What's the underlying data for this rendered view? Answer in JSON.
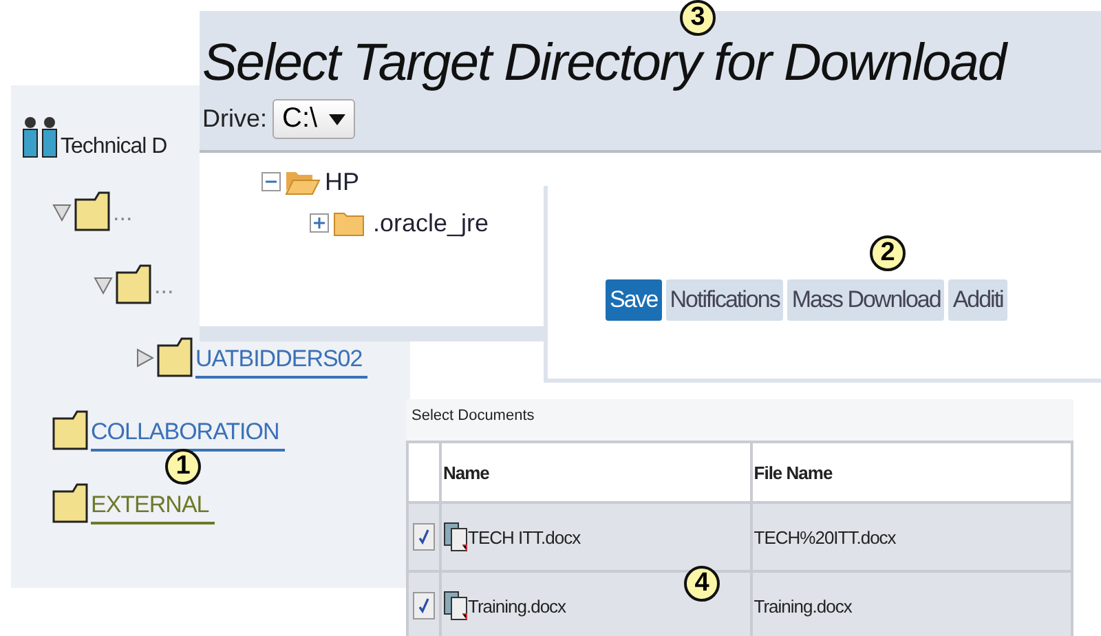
{
  "directory_dialog": {
    "title": "Select Target Directory for Download",
    "drive_label": "Drive:",
    "drive_value": "C:\\",
    "folders": [
      {
        "label": "HP",
        "expanded": true,
        "children": [
          {
            "label": ".oracle_jre",
            "expanded": false
          }
        ]
      }
    ]
  },
  "tree": {
    "root": "Technical D",
    "children": [
      {
        "label": "...",
        "expanded": true,
        "children": [
          {
            "label": "...",
            "expanded": true,
            "children": [
              {
                "label": "UATBIDDERS02",
                "expanded": false,
                "selected": false
              }
            ]
          }
        ]
      },
      {
        "label": "COLLABORATION",
        "selected": false
      },
      {
        "label": "EXTERNAL",
        "selected": true
      }
    ]
  },
  "toolbar": {
    "buttons": [
      {
        "label": "Save",
        "selected": true
      },
      {
        "label": "Notifications",
        "selected": false
      },
      {
        "label": "Mass Download",
        "selected": false
      },
      {
        "label": "Additi",
        "selected": false
      }
    ]
  },
  "documents": {
    "title": "Select Documents",
    "columns": [
      "Name",
      "File Name"
    ],
    "rows": [
      {
        "checked": true,
        "name": "TECH ITT.docx",
        "file_name": "TECH%20ITT.docx"
      },
      {
        "checked": true,
        "name": "Training.docx",
        "file_name": "Training.docx"
      }
    ]
  },
  "callouts": [
    "1",
    "2",
    "3",
    "4"
  ]
}
